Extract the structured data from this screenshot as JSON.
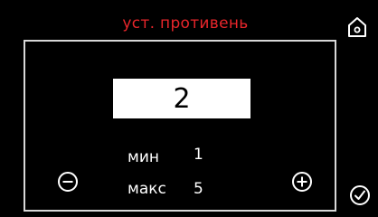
{
  "screen": {
    "title": "уст. противень",
    "title_color": "#e8262b"
  },
  "value": {
    "current": "2"
  },
  "limits": {
    "min_label": "мин",
    "min_value": "1",
    "max_label": "макс",
    "max_value": "5"
  },
  "icons": {
    "home": "home-icon",
    "decrement": "minus-circle-icon",
    "increment": "plus-circle-icon",
    "confirm": "check-circle-icon"
  }
}
